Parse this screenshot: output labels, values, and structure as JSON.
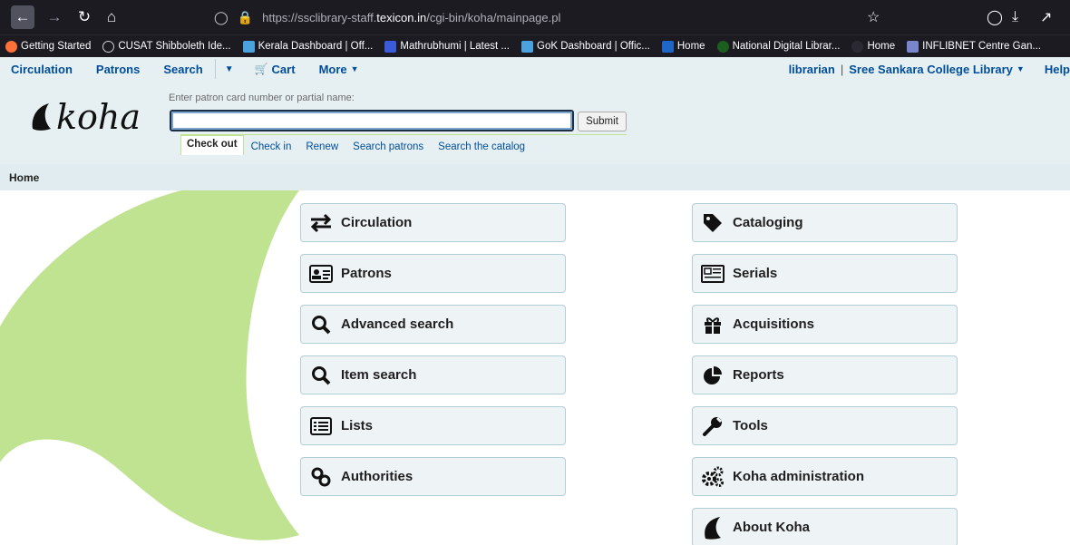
{
  "browser": {
    "url_prefix": "https://ssclibrary-staff.",
    "url_domain": "texicon.in",
    "url_path": "/cgi-bin/koha/mainpage.pl",
    "bookmarks": [
      {
        "label": "Getting Started",
        "color": "#ff7139"
      },
      {
        "label": "CUSAT Shibboleth Ide...",
        "color": "#9aa0a6"
      },
      {
        "label": "Kerala Dashboard | Off...",
        "color": "#4aa3df"
      },
      {
        "label": "Mathrubhumi | Latest ...",
        "color": "#3b5bdb"
      },
      {
        "label": "GoK Dashboard | Offic...",
        "color": "#4aa3df"
      },
      {
        "label": "Home",
        "color": "#1e66c8"
      },
      {
        "label": "National Digital Librar...",
        "color": "#1b5e20"
      },
      {
        "label": "Home",
        "color": "#2b2a33"
      },
      {
        "label": "INFLIBNET Centre Gan...",
        "color": "#7986cb"
      }
    ]
  },
  "nav": {
    "circulation": "Circulation",
    "patrons": "Patrons",
    "search": "Search",
    "cart": "Cart",
    "more": "More",
    "user": "librarian",
    "divider": "|",
    "library": "Sree Sankara College Library",
    "help": "Help"
  },
  "header": {
    "logo_text": "koha",
    "search_label": "Enter patron card number or partial name:",
    "search_value": "",
    "submit_label": "Submit",
    "tabs": [
      "Check out",
      "Check in",
      "Renew",
      "Search patrons",
      "Search the catalog"
    ]
  },
  "breadcrumb": "Home",
  "modules_left": [
    {
      "label": "Circulation",
      "icon": "exchange-icon"
    },
    {
      "label": "Patrons",
      "icon": "id-card-icon"
    },
    {
      "label": "Advanced search",
      "icon": "search-icon"
    },
    {
      "label": "Item search",
      "icon": "search-icon"
    },
    {
      "label": "Lists",
      "icon": "list-icon"
    },
    {
      "label": "Authorities",
      "icon": "link-icon"
    }
  ],
  "modules_right": [
    {
      "label": "Cataloging",
      "icon": "tag-icon"
    },
    {
      "label": "Serials",
      "icon": "newspaper-icon"
    },
    {
      "label": "Acquisitions",
      "icon": "gift-icon"
    },
    {
      "label": "Reports",
      "icon": "pie-chart-icon"
    },
    {
      "label": "Tools",
      "icon": "wrench-icon"
    },
    {
      "label": "Koha administration",
      "icon": "gears-icon"
    },
    {
      "label": "About Koha",
      "icon": "koha-leaf-icon"
    }
  ],
  "colors": {
    "nav_link": "#004d99",
    "header_bg": "#e6f0f2",
    "leaf_green": "#c0e392",
    "button_bg": "#eef3f5"
  }
}
